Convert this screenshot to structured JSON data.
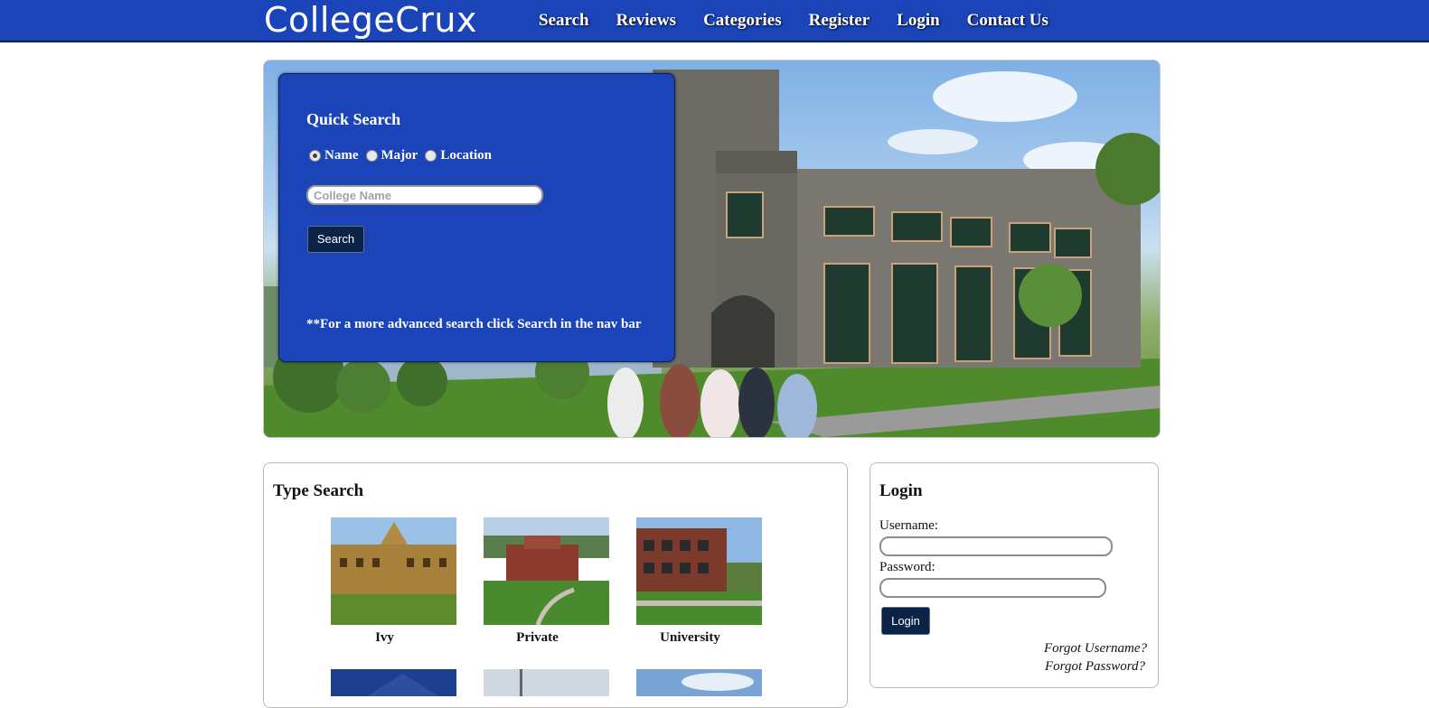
{
  "header": {
    "brand": "CollegeCrux",
    "nav": [
      "Search",
      "Reviews",
      "Categories",
      "Register",
      "Login",
      "Contact Us"
    ]
  },
  "quick_search": {
    "title": "Quick Search",
    "options": [
      {
        "label": "Name",
        "selected": true
      },
      {
        "label": "Major",
        "selected": false
      },
      {
        "label": "Location",
        "selected": false
      }
    ],
    "input_placeholder": "College Name",
    "button": "Search",
    "note": "**For a more advanced search click Search in the nav bar"
  },
  "type_search": {
    "title": "Type Search",
    "types": [
      "Ivy",
      "Private",
      "University"
    ]
  },
  "login": {
    "title": "Login",
    "username_label": "Username:",
    "password_label": "Password:",
    "button": "Login",
    "forgot_username": "Forgot Username?",
    "forgot_password": "Forgot Password?"
  },
  "colors": {
    "header_bg": "#1b44b8",
    "panel_bg": "#1b44b8",
    "button_bg": "#0b2347"
  }
}
